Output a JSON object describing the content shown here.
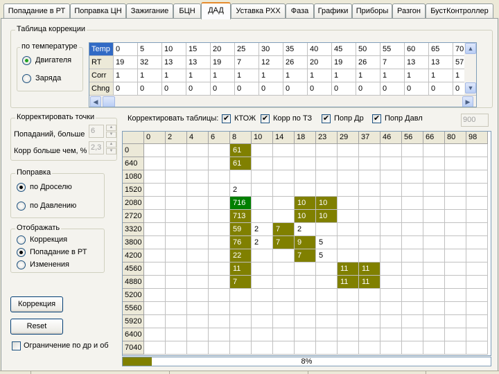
{
  "tabs": [
    {
      "label": "Попадание в РТ"
    },
    {
      "label": "Поправка ЦН"
    },
    {
      "label": "Зажигание"
    },
    {
      "label": "БЦН"
    },
    {
      "label": "ДАД"
    },
    {
      "label": "Уставка РХХ"
    },
    {
      "label": "Фаза"
    },
    {
      "label": "Графики"
    },
    {
      "label": "Приборы"
    },
    {
      "label": "Разгон"
    },
    {
      "label": "БустКонтроллер"
    }
  ],
  "active_tab": "ДАД",
  "correction_table": {
    "title": "Таблица коррекции",
    "temp_group": {
      "title": "по температуре",
      "options": [
        {
          "label": "Двигателя",
          "selected": true
        },
        {
          "label": "Заряда",
          "selected": false
        }
      ]
    },
    "rows": [
      {
        "name": "Temp",
        "values": [
          "0",
          "5",
          "10",
          "15",
          "20",
          "25",
          "30",
          "35",
          "40",
          "45",
          "50",
          "55",
          "60",
          "65",
          "70"
        ]
      },
      {
        "name": "RT",
        "values": [
          "19",
          "32",
          "13",
          "13",
          "19",
          "7",
          "12",
          "26",
          "20",
          "19",
          "26",
          "7",
          "13",
          "13",
          "57"
        ]
      },
      {
        "name": "Corr",
        "values": [
          "1",
          "1",
          "1",
          "1",
          "1",
          "1",
          "1",
          "1",
          "1",
          "1",
          "1",
          "1",
          "1",
          "1",
          "1"
        ]
      },
      {
        "name": "Chng",
        "values": [
          "0",
          "0",
          "0",
          "0",
          "0",
          "0",
          "0",
          "0",
          "0",
          "0",
          "0",
          "0",
          "0",
          "0",
          "0"
        ]
      }
    ],
    "scroll_left": "◀",
    "scroll_right": "▶",
    "scroll_up": "▲",
    "scroll_down": "▼"
  },
  "correct_points": {
    "title": "Корректировать точки",
    "hits_label": "Попаданий, больше",
    "hits_value": "6",
    "corr_label": "Корр больше чем, %",
    "corr_value": "2,3"
  },
  "correct_tables": {
    "label": "Корректировать таблицы:",
    "checks": [
      {
        "label": "КТОЖ",
        "checked": true
      },
      {
        "label": "Корр по ТЗ",
        "checked": true
      },
      {
        "label": "Попр Др",
        "checked": true
      },
      {
        "label": "Попр Давл",
        "checked": true
      }
    ],
    "field_value": "900"
  },
  "amendment": {
    "title": "Поправка",
    "options": [
      {
        "label": "по Дроселю",
        "selected": true
      },
      {
        "label": "по Давлению",
        "selected": false
      }
    ]
  },
  "display": {
    "title": "Отображать",
    "options": [
      {
        "label": "Коррекция",
        "selected": false
      },
      {
        "label": "Попадание в РТ",
        "selected": true
      },
      {
        "label": "Изменения",
        "selected": false
      }
    ]
  },
  "buttons": {
    "correction": "Коррекция",
    "reset": "Reset"
  },
  "limit_check": {
    "label": "Ограничение по др и об",
    "checked": false
  },
  "grid": {
    "columns": [
      "0",
      "2",
      "4",
      "6",
      "8",
      "10",
      "14",
      "18",
      "23",
      "29",
      "37",
      "46",
      "56",
      "66",
      "80",
      "98"
    ],
    "rows": [
      "0",
      "640",
      "1080",
      "1520",
      "2080",
      "2720",
      "3320",
      "3800",
      "4200",
      "4560",
      "4880",
      "5200",
      "5560",
      "5920",
      "6400",
      "7040"
    ],
    "cells": [
      {
        "r": 0,
        "c": 4,
        "v": "61",
        "style": "olive"
      },
      {
        "r": 1,
        "c": 4,
        "v": "61",
        "style": "olive"
      },
      {
        "r": 3,
        "c": 4,
        "v": "2",
        "style": "plain"
      },
      {
        "r": 4,
        "c": 4,
        "v": "716",
        "style": "green"
      },
      {
        "r": 4,
        "c": 7,
        "v": "10",
        "style": "olive"
      },
      {
        "r": 4,
        "c": 8,
        "v": "10",
        "style": "olive"
      },
      {
        "r": 5,
        "c": 4,
        "v": "713",
        "style": "olive"
      },
      {
        "r": 5,
        "c": 7,
        "v": "10",
        "style": "olive"
      },
      {
        "r": 5,
        "c": 8,
        "v": "10",
        "style": "olive"
      },
      {
        "r": 6,
        "c": 4,
        "v": "59",
        "style": "olive"
      },
      {
        "r": 6,
        "c": 5,
        "v": "2",
        "style": "plain"
      },
      {
        "r": 6,
        "c": 6,
        "v": "7",
        "style": "olive"
      },
      {
        "r": 6,
        "c": 7,
        "v": "2",
        "style": "plain"
      },
      {
        "r": 7,
        "c": 4,
        "v": "76",
        "style": "olive"
      },
      {
        "r": 7,
        "c": 5,
        "v": "2",
        "style": "plain"
      },
      {
        "r": 7,
        "c": 6,
        "v": "7",
        "style": "olive"
      },
      {
        "r": 7,
        "c": 7,
        "v": "9",
        "style": "olive"
      },
      {
        "r": 7,
        "c": 8,
        "v": "5",
        "style": "plain"
      },
      {
        "r": 8,
        "c": 4,
        "v": "22",
        "style": "olive"
      },
      {
        "r": 8,
        "c": 7,
        "v": "7",
        "style": "olive"
      },
      {
        "r": 8,
        "c": 8,
        "v": "5",
        "style": "plain"
      },
      {
        "r": 9,
        "c": 4,
        "v": "11",
        "style": "olive"
      },
      {
        "r": 9,
        "c": 9,
        "v": "11",
        "style": "olive"
      },
      {
        "r": 9,
        "c": 10,
        "v": "11",
        "style": "olive"
      },
      {
        "r": 10,
        "c": 4,
        "v": "7",
        "style": "olive"
      },
      {
        "r": 10,
        "c": 9,
        "v": "11",
        "style": "olive"
      },
      {
        "r": 10,
        "c": 10,
        "v": "11",
        "style": "olive"
      }
    ]
  },
  "progress": {
    "value": 0.08,
    "label": "8%"
  },
  "colors": {
    "olive": "#808000",
    "green": "#007f00",
    "selected_header": "#316ac5"
  }
}
